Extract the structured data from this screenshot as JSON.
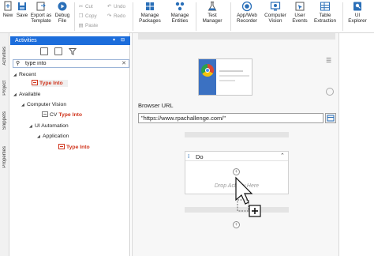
{
  "ribbon": {
    "new": "New",
    "save": "Save",
    "export_template": "Export as\nTemplate",
    "debug_file": "Debug\nFile",
    "cut": "Cut",
    "copy": "Copy",
    "paste": "Paste",
    "undo": "Undo",
    "redo": "Redo",
    "manage_packages": "Manage\nPackages",
    "manage_entities": "Manage\nEntities",
    "test_manager": "Test\nManager",
    "app_web_recorder": "App/Web\nRecorder",
    "computer_vision": "Computer\nVision",
    "user_events": "User\nEvents",
    "table_extraction": "Table\nExtraction",
    "ui_explorer": "UI\nExplorer"
  },
  "side_tabs": [
    "Activities",
    "Project",
    "Snippets",
    "Properties"
  ],
  "activities": {
    "title": "Activities",
    "search_value": "type into",
    "tree": {
      "recent": "Recent",
      "recent_type_into": "Type Into",
      "available": "Available",
      "computer_vision": "Computer Vision",
      "cv_prefix": "CV ",
      "cv_type_into": "Type Into",
      "ui_automation": "UI Automation",
      "application": "Application",
      "app_type_into": "Type Into"
    }
  },
  "workflow": {
    "browser_url_label": "Browser URL",
    "browser_url_value": "\"https://www.rpachallenge.com/\"",
    "do_title": "Do",
    "drop_hint": "Drop Activity Here"
  },
  "colors": {
    "accent": "#1c6ddb",
    "highlight": "#d0341c",
    "ribbon_icon_blue": "#2a6fb8"
  }
}
